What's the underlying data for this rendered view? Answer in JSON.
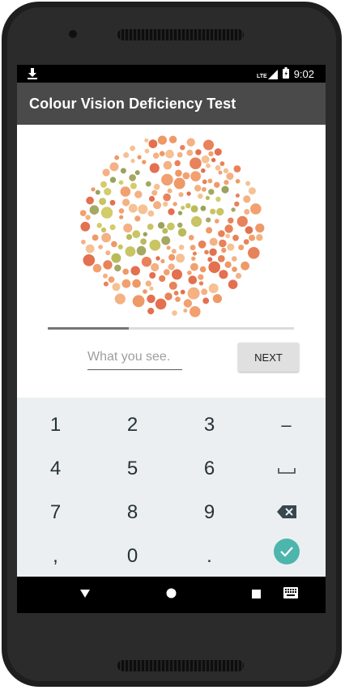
{
  "status": {
    "network": "LTE",
    "time": "9:02"
  },
  "app": {
    "title": "Colour Vision Deficiency Test"
  },
  "test": {
    "progress_fraction": 0.33,
    "answer_placeholder": "What you see.",
    "answer_value": "",
    "next_label": "NEXT"
  },
  "keyboard": {
    "rows": [
      [
        "1",
        "2",
        "3",
        "–"
      ],
      [
        "4",
        "5",
        "6",
        "space"
      ],
      [
        "7",
        "8",
        "9",
        "backspace"
      ],
      [
        ",",
        "0",
        ".",
        "done"
      ]
    ],
    "labels": {
      "k1": "1",
      "k2": "2",
      "k3": "3",
      "dash": "–",
      "k4": "4",
      "k5": "5",
      "k6": "6",
      "k7": "7",
      "k8": "8",
      "k9": "9",
      "comma": ",",
      "k0": "0",
      "period": "."
    }
  },
  "colors": {
    "appbar": "#4a4a4a",
    "keyboard_bg": "#eceff1",
    "done_key": "#4db6ac",
    "plate_background_dots": [
      "#f2a070",
      "#e8825a",
      "#f4b183",
      "#ee9966",
      "#e3704f",
      "#f6c193"
    ],
    "plate_figure_dots": [
      "#b9bb5a",
      "#9aa35c",
      "#c9c464",
      "#a5a862",
      "#d2cc6a"
    ]
  }
}
